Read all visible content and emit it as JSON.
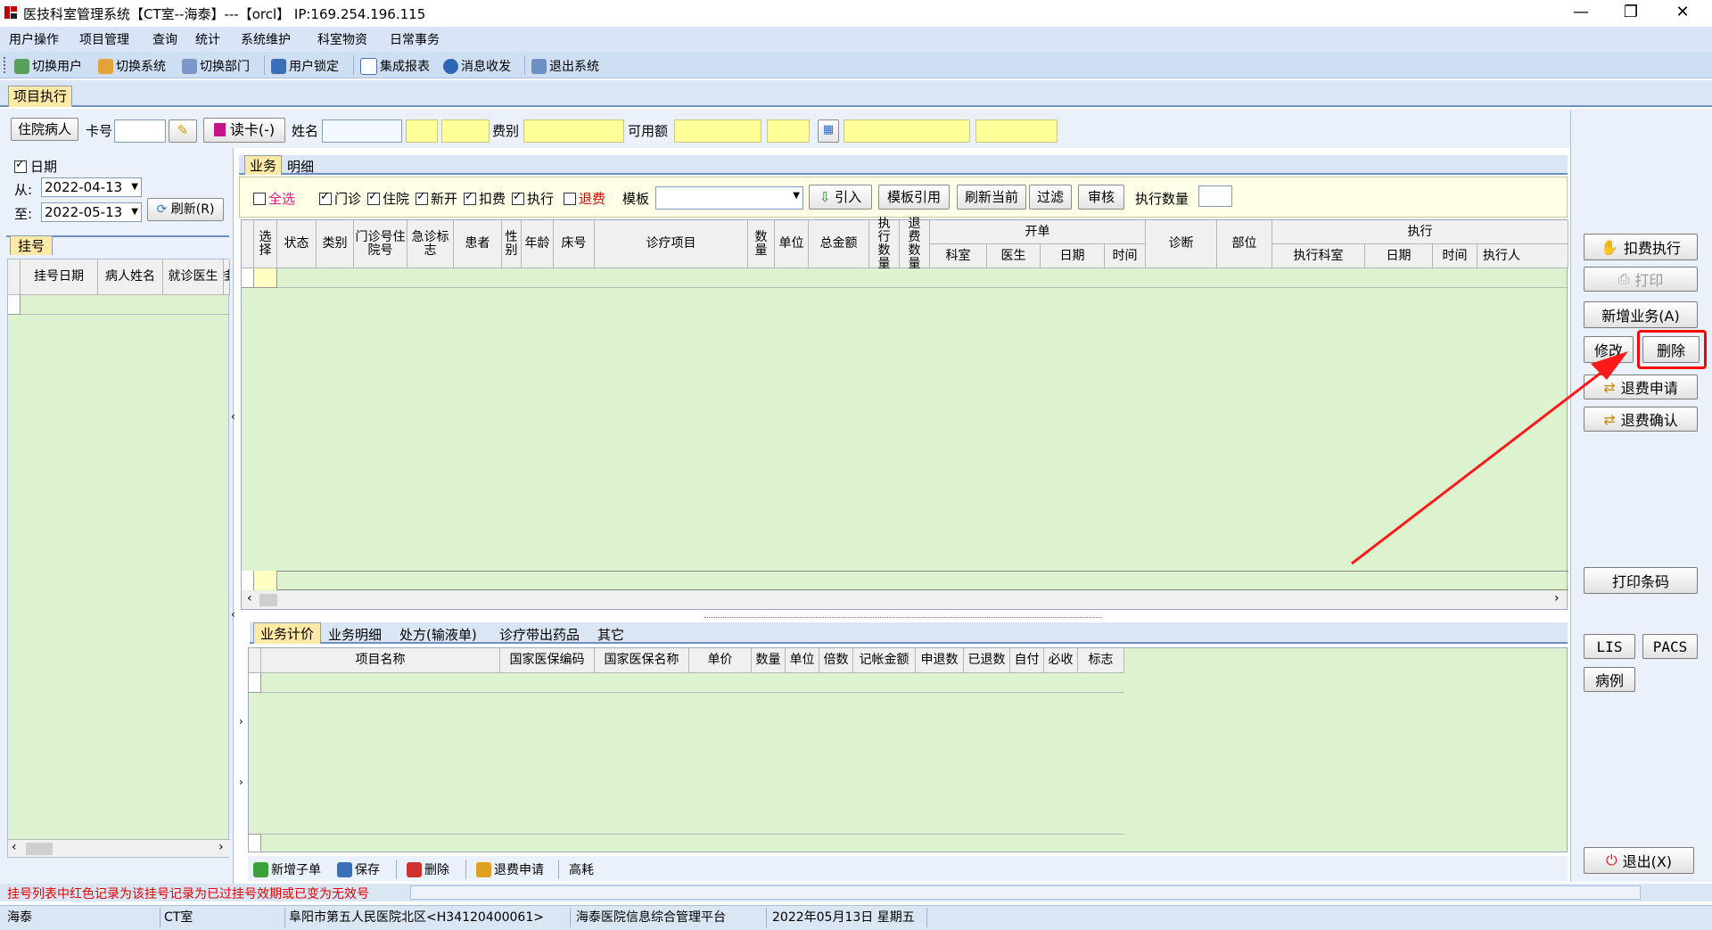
{
  "window": {
    "title": "医技科室管理系统【CT室--海泰】---【orcl】 IP:169.254.196.115",
    "min": "—",
    "max": "❐",
    "close": "✕"
  },
  "menu": [
    "用户操作",
    "项目管理",
    "查询",
    "统计",
    "系统维护",
    "科室物资",
    "日常事务"
  ],
  "toolbar": [
    "切换用户",
    "切换系统",
    "切换部门",
    "用户锁定",
    "集成报表",
    "消息收发",
    "退出系统"
  ],
  "main_tab": "项目执行",
  "filter": {
    "patient_type": "住院病人",
    "card_label": "卡号",
    "read_card": "读卡(-)",
    "name_label": "姓名",
    "fee_type_label": "费别",
    "available_label": "可用额"
  },
  "left": {
    "date_label": "日期",
    "from_label": "从:",
    "from_value": "2022-04-13",
    "to_label": "至:",
    "to_value": "2022-05-13",
    "refresh": "刷新(R)",
    "tab": "挂号",
    "columns": [
      "挂号日期",
      "病人姓名",
      "就诊医生",
      "挂"
    ]
  },
  "center": {
    "tabs": [
      "业务",
      "明细"
    ],
    "checkboxes": [
      {
        "label": "全选",
        "checked": false,
        "color": "#e8178a"
      },
      {
        "label": "门诊",
        "checked": true
      },
      {
        "label": "住院",
        "checked": true
      },
      {
        "label": "新开",
        "checked": true
      },
      {
        "label": "扣费",
        "checked": true
      },
      {
        "label": "执行",
        "checked": true
      },
      {
        "label": "退费",
        "checked": false,
        "color": "#e00000"
      }
    ],
    "template_label": "模板",
    "buttons": [
      "引入",
      "模板引用",
      "刷新当前",
      "过滤",
      "审核"
    ],
    "exec_qty_label": "执行数量",
    "grid_headers": [
      "选择",
      "状态",
      "类别",
      "门诊号住院号",
      "急诊标志",
      "患者",
      "性别",
      "年龄",
      "床号",
      "诊疗项目",
      "数量",
      "单位",
      "总金额",
      "执行数量",
      "退费数量"
    ],
    "group_order": "开单",
    "order_sub": [
      "科室",
      "医生",
      "日期",
      "时间"
    ],
    "diagnosis": "诊断",
    "part": "部位",
    "group_exec": "执行",
    "exec_sub": [
      "执行科室",
      "日期",
      "时间",
      "执行人"
    ],
    "bottom_tabs": [
      "业务计价",
      "业务明细",
      "处方(输液单)",
      "诊疗带出药品",
      "其它"
    ],
    "bottom_headers": [
      "项目名称",
      "国家医保编码",
      "国家医保名称",
      "单价",
      "数量",
      "单位",
      "倍数",
      "记帐金额",
      "申退数",
      "已退数",
      "自付",
      "必收",
      "标志"
    ],
    "bottom_actions": [
      "新增子单",
      "保存",
      "删除",
      "退费申请",
      "高耗"
    ]
  },
  "right": {
    "deduct_exec": "扣费执行",
    "print": "打印",
    "add_business": "新增业务(A)",
    "modify": "修改",
    "delete": "删除",
    "refund_apply": "退费申请",
    "refund_confirm": "退费确认",
    "print_barcode": "打印条码",
    "lis": "LIS",
    "pacs": "PACS",
    "case": "病例",
    "exit": "退出(X)"
  },
  "info_text": "挂号列表中红色记录为该挂号记录为已过挂号效期或已变为无效号",
  "status": [
    "海泰",
    "CT室",
    "阜阳市第五人民医院北区<H34120400061>",
    "海泰医院信息综合管理平台",
    "2022年05月13日 星期五"
  ],
  "colors": {
    "grid_bg": "#ddf3cf",
    "tab_active": "#ffe9a6",
    "highlight": "#ff0000",
    "info_text": "#e00000"
  }
}
